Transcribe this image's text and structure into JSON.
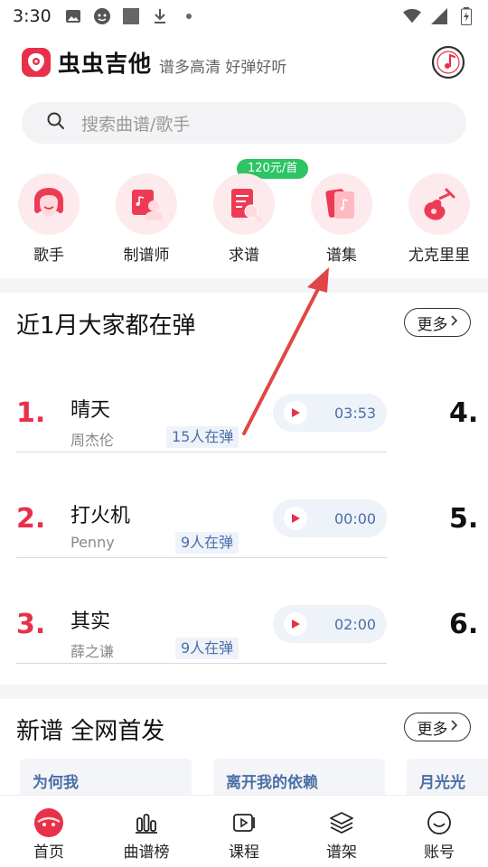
{
  "status_bar": {
    "time": "3:30",
    "icons": [
      "image-icon",
      "headset-icon",
      "square-icon",
      "download-icon",
      "dot-icon"
    ],
    "right_icons": [
      "wifi-icon",
      "signal-icon",
      "battery-icon"
    ]
  },
  "header": {
    "app_name": "虫虫吉他",
    "slogan": "谱多高清 好弹好听",
    "logo_icon": "guitar-pick-logo-icon",
    "disc_icon": "music-disc-icon"
  },
  "search": {
    "placeholder": "搜索曲谱/歌手"
  },
  "categories": {
    "promo_badge": "120元/首",
    "items": [
      {
        "label": "歌手",
        "icon": "singer-face-icon"
      },
      {
        "label": "制谱师",
        "icon": "score-maker-icon"
      },
      {
        "label": "求谱",
        "icon": "request-score-icon"
      },
      {
        "label": "谱集",
        "icon": "score-collection-icon"
      },
      {
        "label": "尤克里里",
        "icon": "ukulele-icon"
      }
    ]
  },
  "trending": {
    "title": "近1月大家都在弹",
    "more_label": "更多",
    "songs": [
      {
        "rank": "1.",
        "name": "晴天",
        "artist": "周杰伦",
        "players": "15人在弹",
        "duration": "03:53"
      },
      {
        "rank": "2.",
        "name": "打火机",
        "artist": "Penny",
        "players": "9人在弹",
        "duration": "00:00"
      },
      {
        "rank": "3.",
        "name": "其实",
        "artist": "薛之谦",
        "players": "9人在弹",
        "duration": "02:00"
      }
    ],
    "next_ranks": [
      "4.",
      "5.",
      "6."
    ]
  },
  "new_scores": {
    "title": "新谱 全网首发",
    "more_label": "更多",
    "cards": [
      "为何我",
      "离开我的依赖",
      "月光光"
    ]
  },
  "bottom_nav": [
    {
      "label": "首页",
      "icon": "home-planet-icon"
    },
    {
      "label": "曲谱榜",
      "icon": "chart-bars-icon"
    },
    {
      "label": "课程",
      "icon": "video-play-icon"
    },
    {
      "label": "谱架",
      "icon": "layers-icon"
    },
    {
      "label": "账号",
      "icon": "smile-account-icon"
    }
  ],
  "colors": {
    "brand": "#e8304a",
    "badge_green": "#2ec466",
    "accent_blue": "#4a6fa5",
    "arrow": "#e04646"
  }
}
